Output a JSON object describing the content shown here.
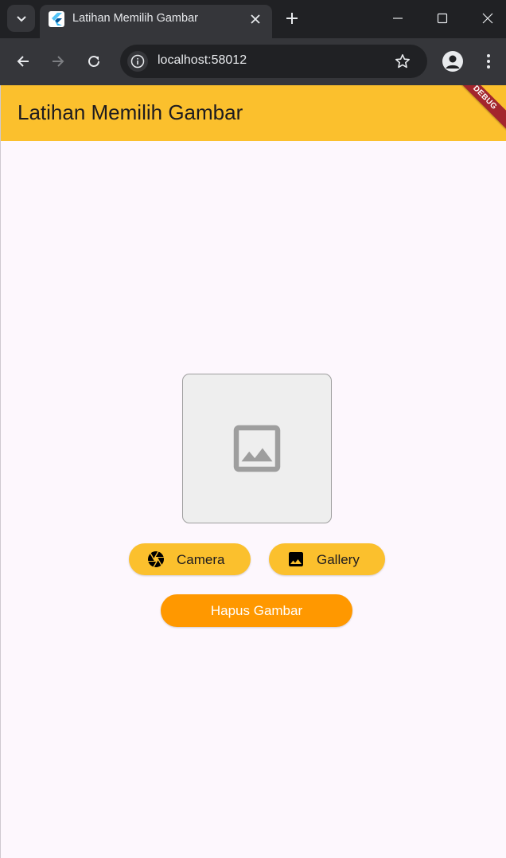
{
  "browser": {
    "tab": {
      "title": "Latihan Memilih Gambar",
      "favicon": "flutter-icon"
    },
    "omnibox": {
      "url": "localhost:58012"
    },
    "icons": {
      "tab_search": "chevron-down-icon",
      "close_tab": "close-icon",
      "new_tab": "plus-icon",
      "minimize": "minimize-icon",
      "maximize": "maximize-icon",
      "close_window": "close-icon",
      "back": "arrow-left-icon",
      "forward": "arrow-right-icon",
      "reload": "reload-icon",
      "site_info": "info-icon",
      "bookmark": "star-icon",
      "profile": "person-icon",
      "menu": "more-vert-icon"
    }
  },
  "app": {
    "appbar": {
      "title": "Latihan Memilih Gambar",
      "background": "#fbc02d"
    },
    "debug_banner": "DEBUG",
    "image_placeholder": {
      "icon": "image-icon"
    },
    "buttons": {
      "camera": {
        "label": "Camera",
        "icon": "camera-icon",
        "color": "#fbc02d"
      },
      "gallery": {
        "label": "Gallery",
        "icon": "image-icon",
        "color": "#fbc02d"
      },
      "hapus": {
        "label": "Hapus Gambar",
        "color": "#ff9800"
      }
    }
  }
}
